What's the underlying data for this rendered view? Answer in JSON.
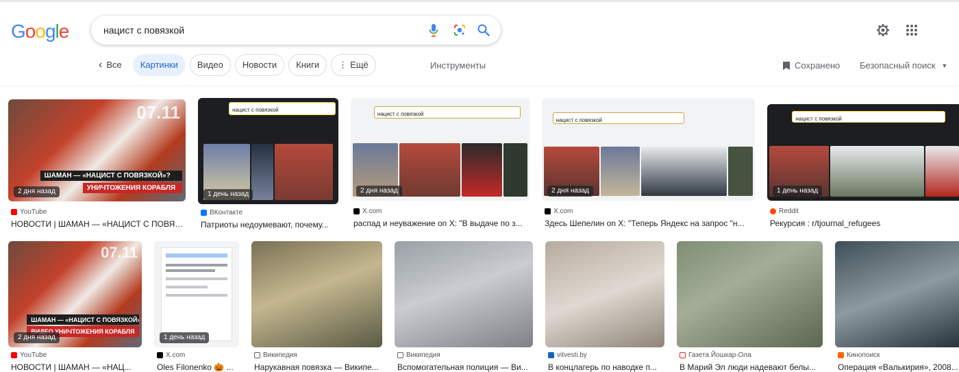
{
  "search": {
    "query": "нацист с повязкой"
  },
  "tabs": [
    {
      "label": "Все"
    },
    {
      "label": "Картинки"
    },
    {
      "label": "Видео"
    },
    {
      "label": "Новости"
    },
    {
      "label": "Книги"
    },
    {
      "label": "Ещё"
    }
  ],
  "toolbar": {
    "tools": "Инструменты",
    "saved": "Сохранено",
    "safe_search": "Безопасный поиск"
  },
  "colors": {
    "accent": "#1a73e8",
    "active_tab_bg": "#e8f0fe",
    "youtube": "#ff0000",
    "vk": "#0077ff",
    "x": "#000000",
    "reddit": "#ff4500"
  },
  "results": [
    {
      "source": "YouTube",
      "title": "НОВОСТИ | ШАМАН — «НАЦИСТ С ПОВЯЗ...",
      "age": "2 дня назад",
      "overlay_1": "ШАМАН — «НАЦИСТ С ПОВЯЗКОЙ»?",
      "overlay_2": "УНИЧТОЖЕНИЯ КОРАБЛЯ",
      "date_mark": "07.11"
    },
    {
      "source": "ВКонтакте",
      "title": "Патриоты недоумевают, почему...",
      "age": "1 день назад",
      "overlay_1": "нацист с повязкой"
    },
    {
      "source": "X.com",
      "title": "распад и неуважение on X: \"В выдаче по з...",
      "age": "2 дня назад",
      "overlay_1": "нацист с повязкой"
    },
    {
      "source": "X.com",
      "title": "Здесь Шепелин on X: \"Теперь Яндекс на запрос \"н...",
      "age": "2 дня назад",
      "overlay_1": "нацист с повязкой"
    },
    {
      "source": "Reddit",
      "title": "Рекурсия : r/tjournal_refugees",
      "age": "1 день назад",
      "overlay_1": "нацист с повязкой"
    },
    {
      "source": "YouTube",
      "title": "НОВОСТИ | ШАМАН — «НАЦ...",
      "age": "2 дня назад",
      "overlay_1": "ШАМАН — «НАЦИСТ С ПОВЯЗКОЙ»?",
      "overlay_2": "ВИДЕО УНИЧТОЖЕНИЯ КОРАБЛЯ",
      "date_mark": "07.11"
    },
    {
      "source": "X.com",
      "title": "Oles Filonenko 🎃 ...",
      "age": "1 день назад"
    },
    {
      "source": "Википедия",
      "title": "Нарукавная повязка — Википе..."
    },
    {
      "source": "Википедия",
      "title": "Вспомогательная полиция — Ви..."
    },
    {
      "source": "vitvesti.by",
      "title": "В концлагерь по наводке п..."
    },
    {
      "source": "Газета Йошкар-Ола",
      "title": "В Марий Эл люди надевают белы..."
    },
    {
      "source": "Кинопоиск",
      "title": "Операция «Валькирия», 2008..."
    }
  ]
}
